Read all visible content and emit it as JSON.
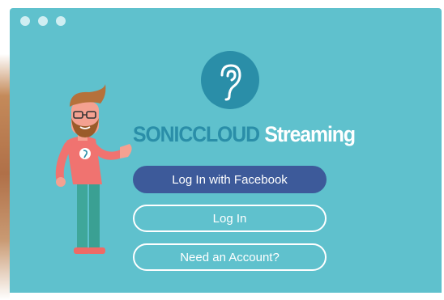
{
  "window": {
    "traffic_lights": [
      "close",
      "minimize",
      "maximize"
    ]
  },
  "brand": {
    "name_main": "SONICCLOUD",
    "name_sub": "Streaming",
    "logo_icon": "ear-icon"
  },
  "actions": {
    "facebook_login_label": "Log In with Facebook",
    "login_label": "Log In",
    "signup_label": "Need an Account?"
  },
  "colors": {
    "background": "#5fc1cd",
    "brand_dark": "#2a8ea8",
    "facebook": "#3d5a9a",
    "text_light": "#ffffff"
  }
}
